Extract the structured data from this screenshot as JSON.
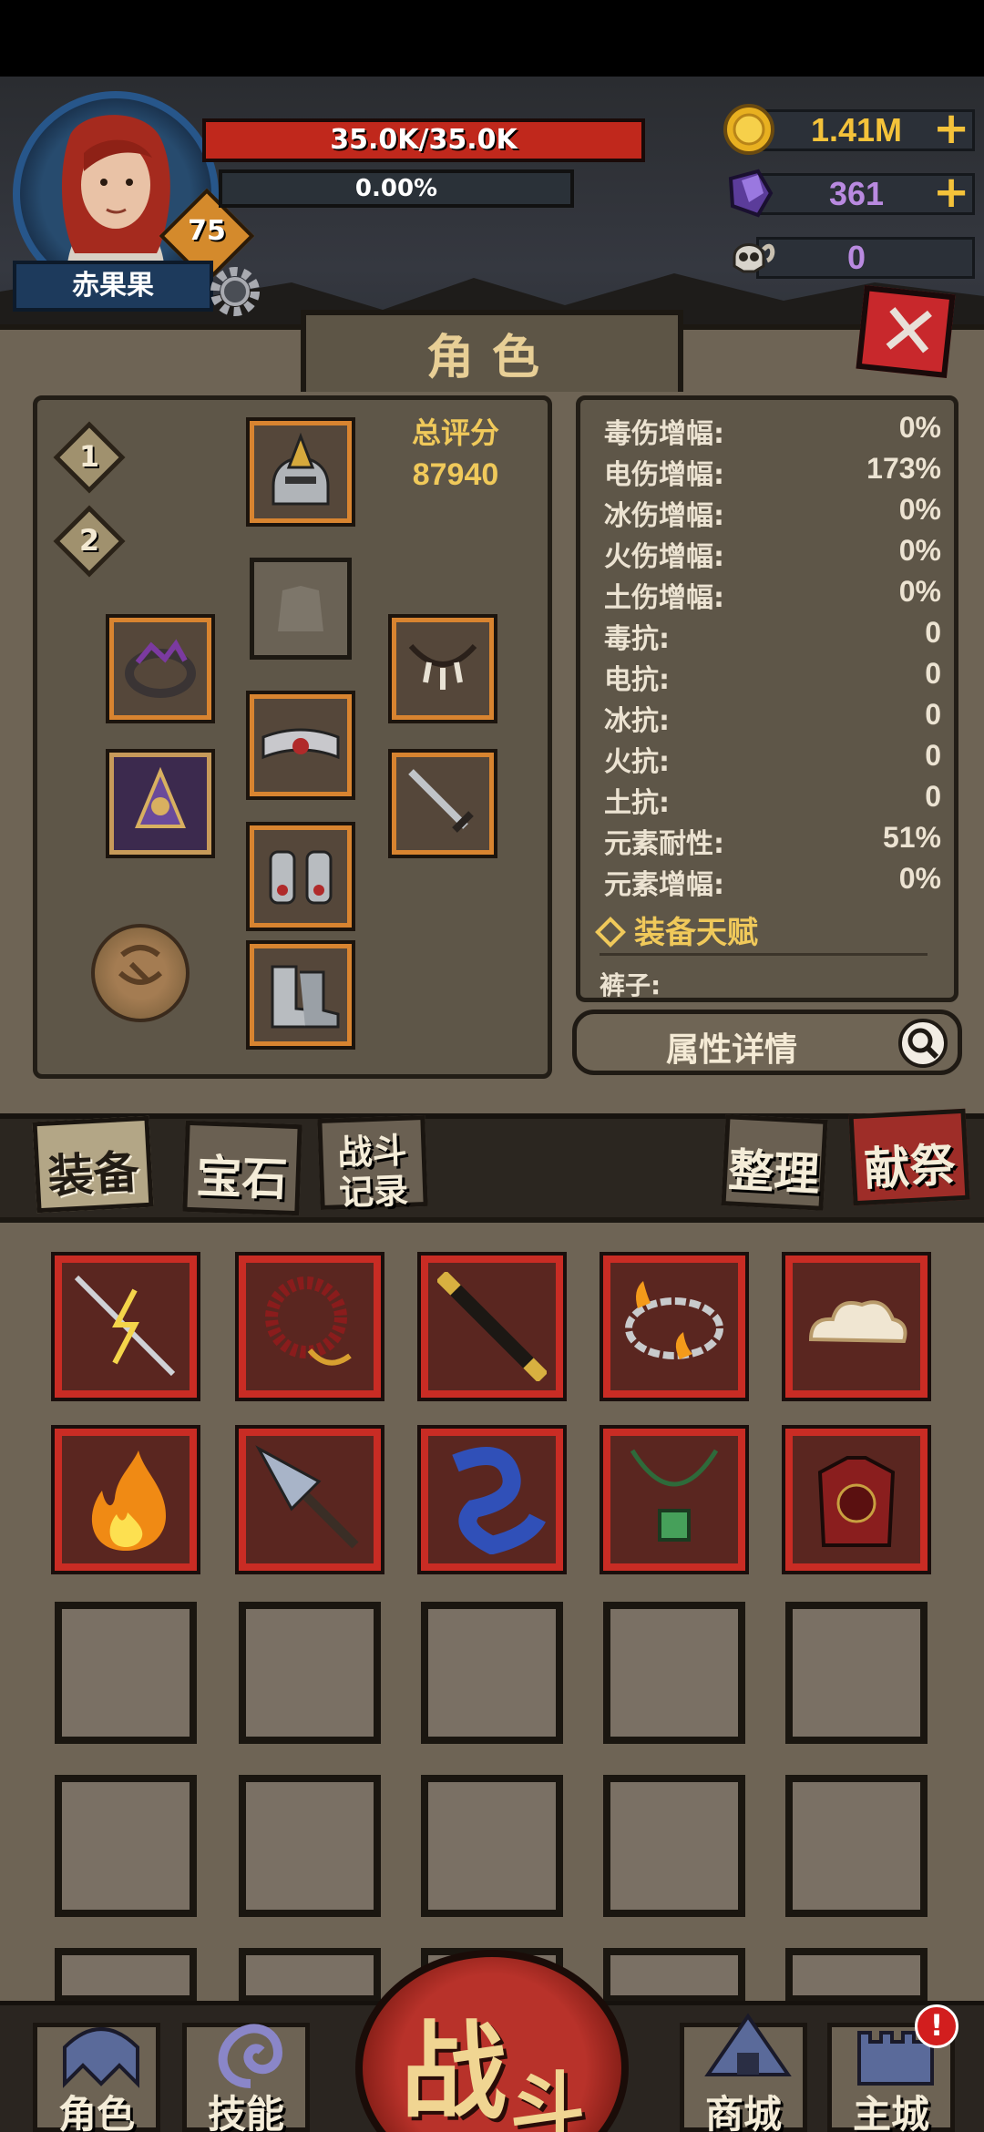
{
  "player": {
    "name": "赤果果",
    "level": "75",
    "hp": "35.0K/35.0K",
    "exp": "0.00%"
  },
  "currencies": {
    "gold": "1.41M",
    "crystal": "361",
    "skull": "0",
    "gold_color": "#f4c23a",
    "crystal_color": "#b98ae0",
    "skull_color": "#b98ae0"
  },
  "panel": {
    "title": "角色",
    "tiers": [
      "1",
      "2"
    ],
    "score_label": "总评分",
    "score_value": "87940"
  },
  "stats": [
    {
      "label": "毒伤增幅:",
      "value": "0%"
    },
    {
      "label": "电伤增幅:",
      "value": "173%"
    },
    {
      "label": "冰伤增幅:",
      "value": "0%"
    },
    {
      "label": "火伤增幅:",
      "value": "0%"
    },
    {
      "label": "土伤增幅:",
      "value": "0%"
    },
    {
      "label": "毒抗:",
      "value": "0"
    },
    {
      "label": "电抗:",
      "value": "0"
    },
    {
      "label": "冰抗:",
      "value": "0"
    },
    {
      "label": "火抗:",
      "value": "0"
    },
    {
      "label": "土抗:",
      "value": "0"
    },
    {
      "label": "元素耐性:",
      "value": "51%"
    },
    {
      "label": "元素增幅:",
      "value": "0%"
    }
  ],
  "talent": {
    "title": "装备天赋",
    "first_item": "裤子:"
  },
  "detail_button": "属性详情",
  "tabs": {
    "equipment": "装备",
    "gems": "宝石",
    "battle_log_1": "战斗",
    "battle_log_2": "记录",
    "sort": "整理",
    "sacrifice": "献祭"
  },
  "inventory_items": [
    "lightning-spear",
    "red-rosary",
    "black-staff",
    "flame-chain",
    "cloud",
    "fire",
    "crystal-dagger",
    "blue-scarf",
    "jade-necklace",
    "red-armor"
  ],
  "nav": {
    "character": "角色",
    "skills": "技能",
    "battle_1": "战",
    "battle_2": "斗",
    "shop": "商城",
    "main_city": "主城",
    "alert": "!"
  }
}
